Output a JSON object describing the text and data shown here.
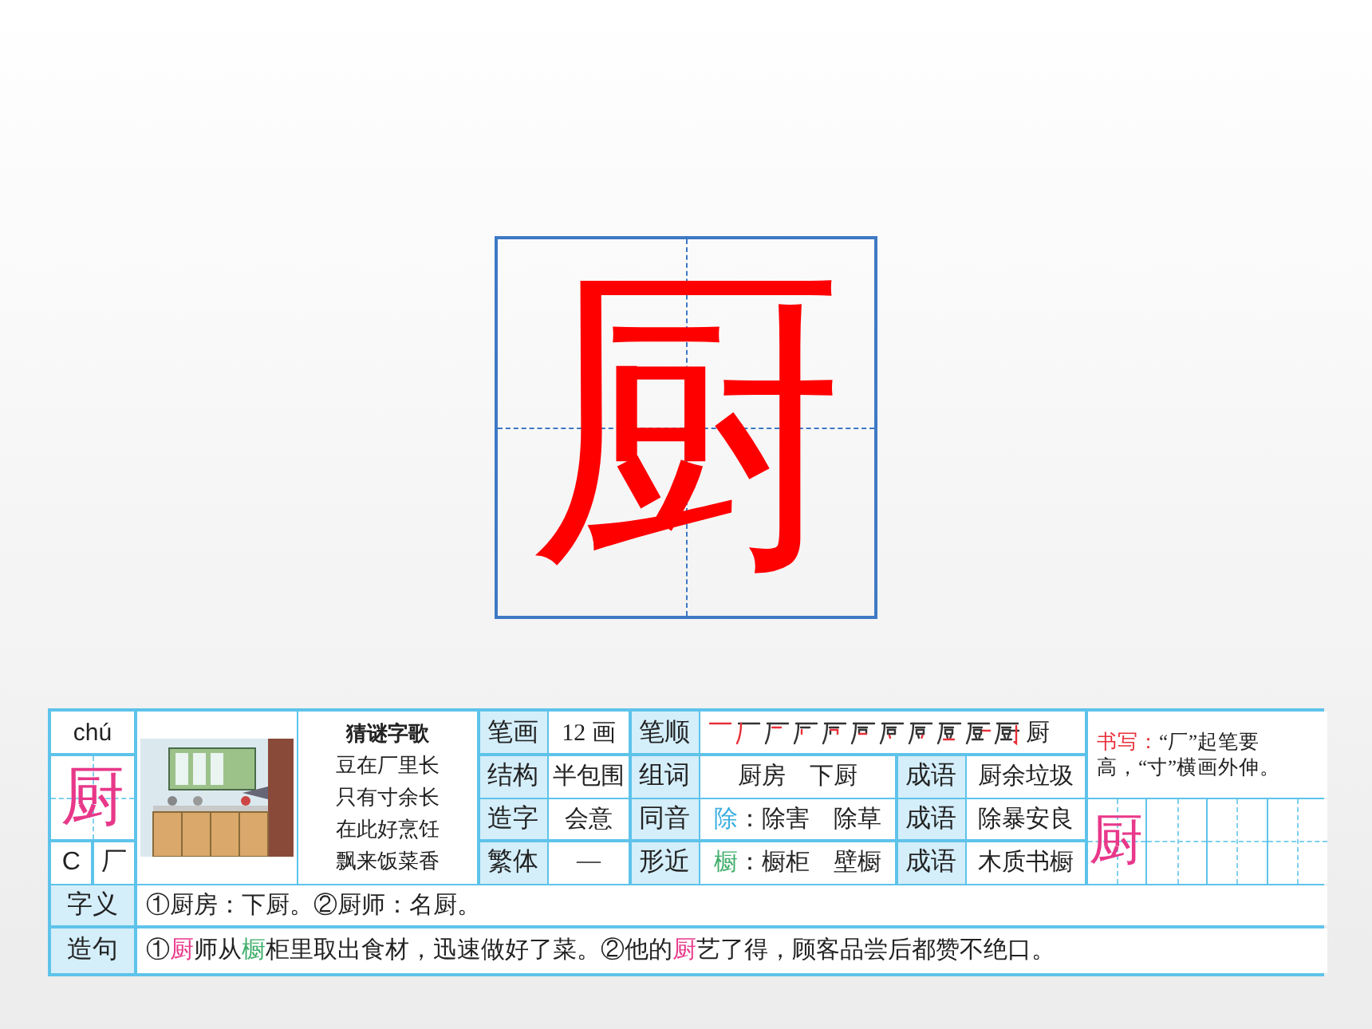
{
  "character": "厨",
  "card": {
    "pinyin": "chú",
    "character": "厨",
    "radical_letter": "C",
    "radical": "厂",
    "riddle": {
      "title": "猜谜字歌",
      "lines": [
        "豆在厂里长",
        "只有寸余长",
        "在此好烹饪",
        "飘来饭菜香"
      ]
    },
    "strokes": {
      "label": "笔画",
      "value": "12 画"
    },
    "order": {
      "label": "笔顺",
      "last": "厨"
    },
    "structure": {
      "label": "结构",
      "value": "半包围"
    },
    "words": {
      "label": "组词",
      "value": "厨房　下厨"
    },
    "formation": {
      "label": "造字",
      "value": "会意"
    },
    "homophone": {
      "label": "同音",
      "segments": [
        {
          "text": "除",
          "color": "#3aaee0"
        },
        {
          "text": "：除害　除草"
        }
      ]
    },
    "traditional": {
      "label": "繁体",
      "value": "—"
    },
    "similar": {
      "label": "形近",
      "segments": [
        {
          "text": "橱",
          "color": "#3fae6a"
        },
        {
          "text": "：橱柜　壁橱"
        }
      ]
    },
    "idioms": [
      {
        "label": "成语",
        "value": "厨余垃圾"
      },
      {
        "label": "成语",
        "value": "除暴安良"
      },
      {
        "label": "成语",
        "value": "木质书橱"
      }
    ],
    "writing_tip": [
      {
        "text": "书写：",
        "color": "#e8303a"
      },
      {
        "text": "“厂”起笔要高，“寸”横画外伸。"
      }
    ],
    "practice_character": "厨",
    "meaning": {
      "label": "字义",
      "text": "①厨房：下厨。②厨师：名厨。"
    },
    "sentence": {
      "label": "造句",
      "segments": [
        {
          "text": "①"
        },
        {
          "text": "厨",
          "color": "#e8388a"
        },
        {
          "text": "师从"
        },
        {
          "text": "橱",
          "color": "#3fae6a"
        },
        {
          "text": "柜里取出食材，迅速做好了菜。②他的"
        },
        {
          "text": "厨",
          "color": "#e8388a"
        },
        {
          "text": "艺了得，顾客品尝后都赞不绝口。"
        }
      ]
    }
  }
}
